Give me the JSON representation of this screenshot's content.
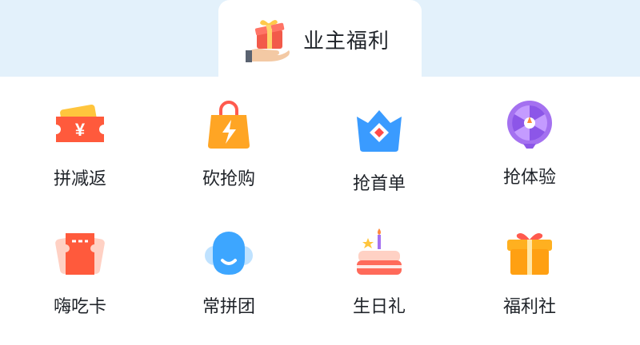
{
  "header": {
    "title": "业主福利",
    "icon": "gift-in-hand-icon"
  },
  "items": [
    {
      "label": "拼减返",
      "icon": "yuan-ticket-icon"
    },
    {
      "label": "砍抢购",
      "icon": "shopping-bag-lightning-icon"
    },
    {
      "label": "抢首单",
      "icon": "crown-icon"
    },
    {
      "label": "抢体验",
      "icon": "spin-wheel-icon"
    },
    {
      "label": "嗨吃卡",
      "icon": "food-card-icon"
    },
    {
      "label": "常拼团",
      "icon": "group-people-icon"
    },
    {
      "label": "生日礼",
      "icon": "birthday-cake-icon"
    },
    {
      "label": "福利社",
      "icon": "gift-box-icon"
    }
  ]
}
